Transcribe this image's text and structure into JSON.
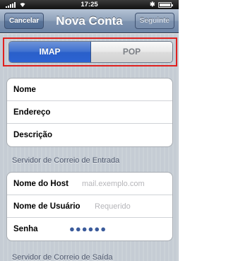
{
  "status_bar": {
    "time": "17:25",
    "bluetooth": "✱"
  },
  "nav": {
    "cancel_label": "Cancelar",
    "title": "Nova Conta",
    "next_label": "Seguinte"
  },
  "segmented": {
    "options": [
      "IMAP",
      "POP"
    ],
    "selected": "IMAP"
  },
  "account_fields": [
    {
      "label": "Nome",
      "value": ""
    },
    {
      "label": "Endereço",
      "value": ""
    },
    {
      "label": "Descrição",
      "value": ""
    }
  ],
  "incoming_header": "Servidor de Correio de Entrada",
  "incoming_fields": [
    {
      "label": "Nome do Host",
      "placeholder": "mail.exemplo.com"
    },
    {
      "label": "Nome de Usuário",
      "placeholder": "Requerido"
    },
    {
      "label": "Senha",
      "value": "●●●●●●"
    }
  ],
  "outgoing_header": "Servidor de Correio de Saída",
  "colors": {
    "nav": "#7e93b0",
    "segment_active": "#3d6fd0",
    "highlight": "#e0201e",
    "background": "#c5ccd4"
  }
}
